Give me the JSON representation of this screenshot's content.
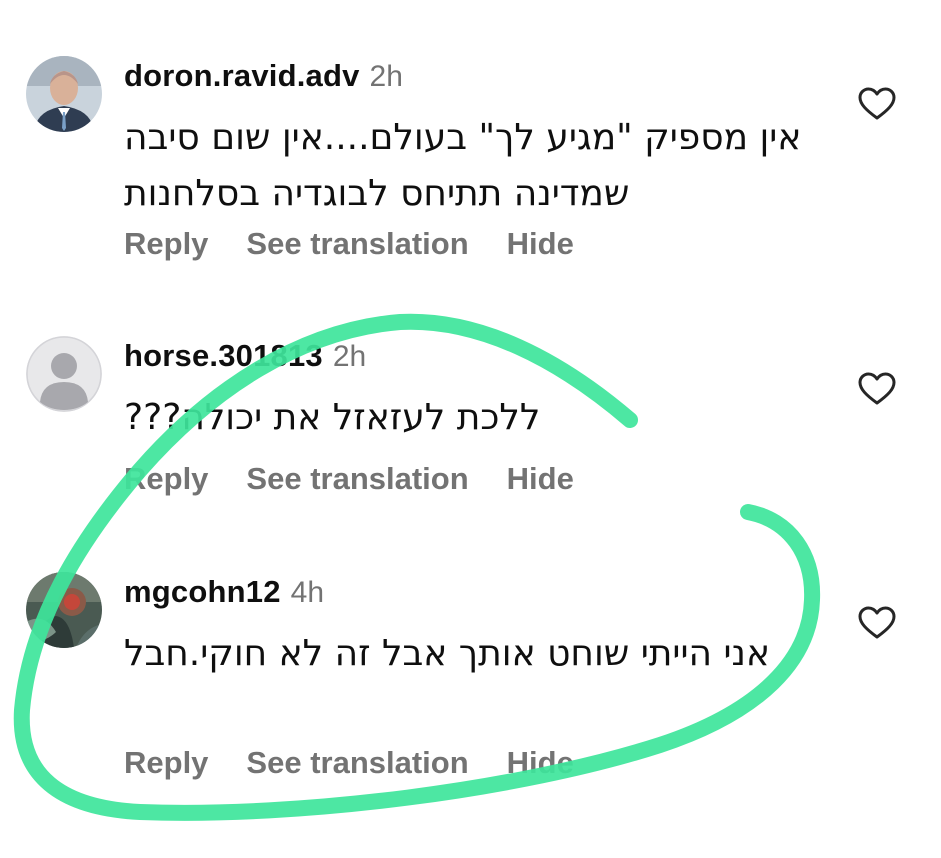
{
  "comments": [
    {
      "username": "doron.ravid.adv",
      "time": "2h",
      "text": "אין מספיק \"מגיע לך\" בעולם....אין שום סיבה שמדינה תתיחס לבוגדיה בסלחנות",
      "actions": {
        "reply": "Reply",
        "translate": "See translation",
        "hide": "Hide"
      },
      "avatar": "profile-photo"
    },
    {
      "username": "horse.301813",
      "time": "2h",
      "text": "ללכת לעזאזל את יכולה???",
      "actions": {
        "reply": "Reply",
        "translate": "See translation",
        "hide": "Hide"
      },
      "avatar": "default-person"
    },
    {
      "username": "mgcohn12",
      "time": "4h",
      "text": "אני הייתי שוחט אותך אבל זה לא חוקי.חבל",
      "actions": {
        "reply": "Reply",
        "translate": "See translation",
        "hide": "Hide"
      },
      "avatar": "profile-photo"
    }
  ],
  "icons": {
    "like": "heart-outline-icon"
  },
  "colors": {
    "secondary_text": "#737373",
    "annotation_stroke": "#3ee59b",
    "default_avatar_bg": "#d9d9dd",
    "default_avatar_fg": "#a8a8ad"
  }
}
